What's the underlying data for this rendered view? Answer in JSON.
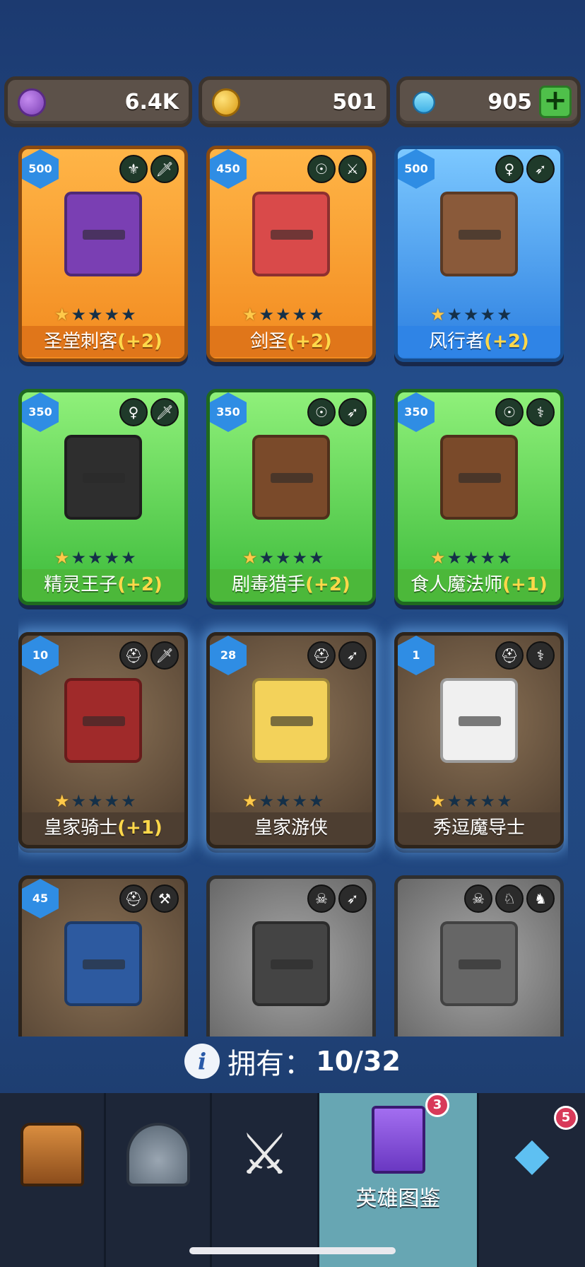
{
  "currency": {
    "purple": {
      "value": "6.4K",
      "icon": "purple-coin-icon"
    },
    "gold": {
      "value": "501",
      "icon": "gold-coin-icon"
    },
    "gems": {
      "value": "905",
      "icon": "gem-icon",
      "add": "+"
    }
  },
  "heroes": [
    {
      "level": "500",
      "name": "圣堂刺客",
      "bonus": "(+2)",
      "stars": 1,
      "tiles": [
        "⚜",
        "🗡"
      ],
      "theme": "orange"
    },
    {
      "level": "450",
      "name": "剑圣",
      "bonus": "(+2)",
      "stars": 1,
      "tiles": [
        "☉",
        "⚔"
      ],
      "theme": "orange"
    },
    {
      "level": "500",
      "name": "风行者",
      "bonus": "(+2)",
      "stars": 1,
      "tiles": [
        "♀",
        "➶"
      ],
      "theme": "blue"
    },
    {
      "level": "350",
      "name": "精灵王子",
      "bonus": "(+2)",
      "stars": 1,
      "tiles": [
        "♀",
        "🗡"
      ],
      "theme": "green"
    },
    {
      "level": "350",
      "name": "剧毒猎手",
      "bonus": "(+2)",
      "stars": 1,
      "tiles": [
        "☉",
        "➶"
      ],
      "theme": "green"
    },
    {
      "level": "350",
      "name": "食人魔法师",
      "bonus": "(+1)",
      "stars": 1,
      "tiles": [
        "☉",
        "⚕"
      ],
      "theme": "green"
    },
    {
      "level": "10",
      "name": "皇家骑士",
      "bonus": "(+1)",
      "stars": 1,
      "tiles": [
        "⛑",
        "🗡"
      ],
      "theme": "brown"
    },
    {
      "level": "28",
      "name": "皇家游侠",
      "bonus": "",
      "stars": 1,
      "tiles": [
        "⛑",
        "➶"
      ],
      "theme": "brown"
    },
    {
      "level": "1",
      "name": "秀逗魔导士",
      "bonus": "",
      "stars": 1,
      "tiles": [
        "⛑",
        "⚕"
      ],
      "theme": "brown"
    },
    {
      "level": "45",
      "name": "",
      "bonus": "",
      "stars": 0,
      "tiles": [
        "⛑",
        "⚒"
      ],
      "theme": "brown"
    },
    {
      "level": "",
      "name": "",
      "bonus": "",
      "stars": 0,
      "tiles": [
        "☠",
        "➶"
      ],
      "theme": "gray"
    },
    {
      "level": "",
      "name": "",
      "bonus": "",
      "stars": 0,
      "tiles": [
        "☠",
        "♘",
        "♞"
      ],
      "theme": "gray"
    }
  ],
  "owned": {
    "label": "拥有：",
    "count": "10/32",
    "info_icon": "i"
  },
  "nav": {
    "items": [
      {
        "icon": "chest-icon"
      },
      {
        "icon": "helmet-icon"
      },
      {
        "icon": "crossed-swords-icon",
        "glyph": "⚔"
      },
      {
        "icon": "spellbook-icon",
        "label": "英雄图鉴",
        "badge": "3"
      },
      {
        "icon": "amulet-icon",
        "glyph": "◆",
        "badge": "5"
      }
    ]
  }
}
